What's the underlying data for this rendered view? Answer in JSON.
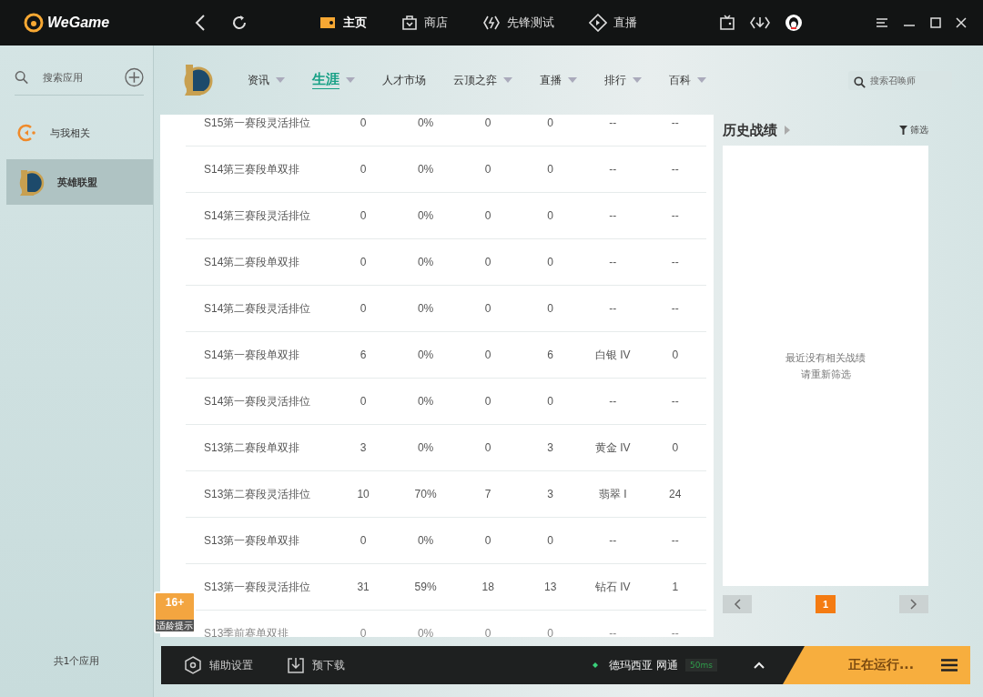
{
  "app_name": "WeGame",
  "top_nav": [
    {
      "label": "主页",
      "selected": true
    },
    {
      "label": "商店",
      "selected": false
    },
    {
      "label": "先锋测试",
      "selected": false
    },
    {
      "label": "直播",
      "selected": false
    }
  ],
  "sidebar": {
    "search_placeholder": "搜索应用",
    "items": [
      {
        "label": "与我相关",
        "selected": false
      },
      {
        "label": "英雄联盟",
        "selected": true
      }
    ],
    "footer": "共1个应用"
  },
  "game_tabs": [
    {
      "label": "资讯",
      "dropdown": true,
      "selected": false
    },
    {
      "label": "生涯",
      "dropdown": true,
      "selected": true
    },
    {
      "label": "人才市场",
      "dropdown": false,
      "selected": false
    },
    {
      "label": "云顶之弈",
      "dropdown": true,
      "selected": false
    },
    {
      "label": "直播",
      "dropdown": true,
      "selected": false
    },
    {
      "label": "排行",
      "dropdown": true,
      "selected": false
    },
    {
      "label": "百科",
      "dropdown": true,
      "selected": false
    }
  ],
  "summoner_search": {
    "placeholder": "搜索召唤师"
  },
  "table": {
    "rows": [
      [
        "S15第一赛段灵活排位",
        "0",
        "0%",
        "0",
        "0",
        "--",
        "--"
      ],
      [
        "S14第三赛段单双排",
        "0",
        "0%",
        "0",
        "0",
        "--",
        "--"
      ],
      [
        "S14第三赛段灵活排位",
        "0",
        "0%",
        "0",
        "0",
        "--",
        "--"
      ],
      [
        "S14第二赛段单双排",
        "0",
        "0%",
        "0",
        "0",
        "--",
        "--"
      ],
      [
        "S14第二赛段灵活排位",
        "0",
        "0%",
        "0",
        "0",
        "--",
        "--"
      ],
      [
        "S14第一赛段单双排",
        "6",
        "0%",
        "0",
        "6",
        "白银 IV",
        "0"
      ],
      [
        "S14第一赛段灵活排位",
        "0",
        "0%",
        "0",
        "0",
        "--",
        "--"
      ],
      [
        "S13第二赛段单双排",
        "3",
        "0%",
        "0",
        "3",
        "黄金 IV",
        "0"
      ],
      [
        "S13第二赛段灵活排位",
        "10",
        "70%",
        "7",
        "3",
        "翡翠 I",
        "24"
      ],
      [
        "S13第一赛段单双排",
        "0",
        "0%",
        "0",
        "0",
        "--",
        "--"
      ],
      [
        "S13第一赛段灵活排位",
        "31",
        "59%",
        "18",
        "13",
        "钻石 IV",
        "1"
      ],
      [
        "S13季前赛单双排",
        "0",
        "0%",
        "0",
        "0",
        "--",
        "--"
      ]
    ]
  },
  "history": {
    "title": "历史战绩",
    "filter": "筛选",
    "empty_lines": [
      "最近没有相关战绩",
      "请重新筛选"
    ],
    "pages": [
      {
        "label": "1",
        "selected": true
      }
    ]
  },
  "age_badge": {
    "rating": "16+",
    "caption": "适龄提示"
  },
  "bottom_bar": {
    "assist": "辅助设置",
    "predownload": "预下载",
    "server": "德玛西亚 网通",
    "ping": "50ms",
    "status": "正在运行..."
  }
}
